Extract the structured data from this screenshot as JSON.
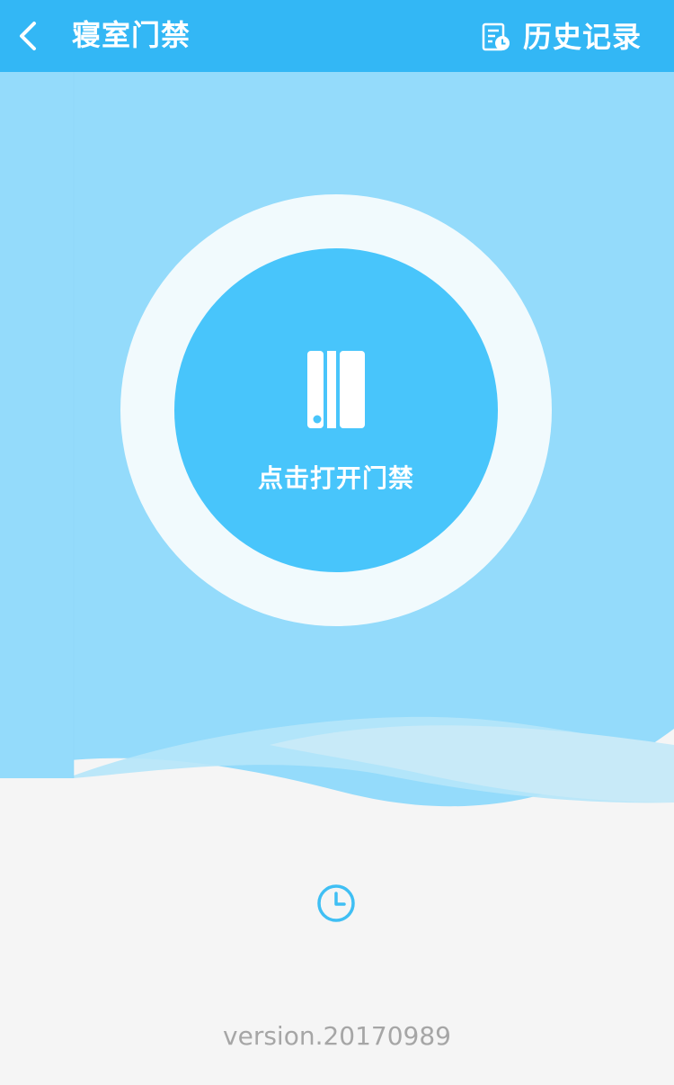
{
  "header": {
    "back_icon": "chevron-left-icon",
    "title": "寝室门禁",
    "history_icon": "history-record-icon",
    "history_label": "历史记录"
  },
  "main": {
    "door_icon": "door-icon",
    "open_label": "点击打开门禁",
    "clock_icon": "clock-icon",
    "version": "version.20170989"
  },
  "colors": {
    "header_bg": "#33b7f5",
    "hero_bg": "#94dbfb",
    "ring": "#f1fafd",
    "button": "#48c5fb",
    "page_bg": "#f5f5f5",
    "version_text": "#a6a6a6"
  }
}
